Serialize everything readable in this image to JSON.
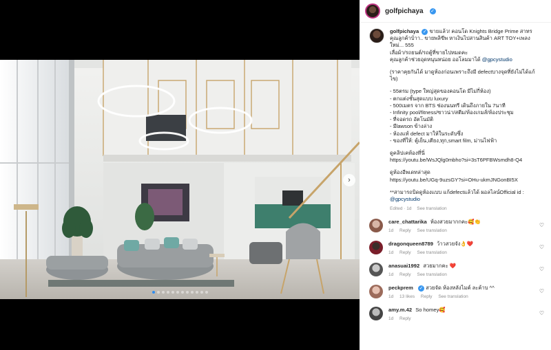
{
  "post": {
    "username": "golfpichaya",
    "carousel": {
      "total_slides": 12,
      "active_slide": 1
    }
  },
  "caption": {
    "username": "golfpichaya",
    "lines": [
      "ขายแล้ว! คอนโด Knights Bridge Prime สาทร",
      "คุณลูกค้าบ้าา.. ขายพลิขีพ หาเงินไปสานสินค้า ART TOY+เพลง",
      "ใหม่... 555",
      "เลื่อผ้า/รถยนต์/รถตู้ที่ขายไปหมดคะ",
      "คุณลูกค้าช่วยอุดหนุนหน่อย ออโลมมาได้"
    ],
    "mention1": "@gpcystudio",
    "paragraph2": [
      "(ราคาคุยกันได้ มาดูห้องก่อนเพราะถึงมี defectบางจุดที่ยังไม่ได้แก้",
      "ไข)"
    ],
    "features": [
      "- 55ตรม (type ใหญ่สุดของคอนโด มีไม่กี่ห้อง)",
      "- ตกแต่งชั้นสุดแบบ luxury",
      "- 500เมตร จาก BTS ช่องนนทรี เดินถึงภายใน 7นาที",
      "- Infinity pool/fitness/ซาวน่า/สตีม/ห้องเกมส์/ห้องประชุม",
      "- ที่จอดรถ อัตโนมัติ",
      "- มีlawson ข้างล่าง",
      "- ห้องแท้ defect มาให้ในระดับซึ่ง",
      "- ของที่ให้: ตู้เย็น,เตียง,ทุก,smart film, ม่านไฟฟ้า"
    ],
    "link1_label": "ดูคลิปเคห้องที่นี่",
    "link1_url": "https://youtu.be/WsJQlg0mbho?si=3sT6PFBWsmdh8-Q4",
    "link2_label": "ดูห้องอีพเดทล่าสุด",
    "link2_url": "https://youtu.be/UGq-9uzsGY?si=OHu-ukmJNGonBI5X",
    "footer_line": "**สามารถบิดดูห้องแบบ แก้defectแล้วได้ ผอลไลน์Official id :",
    "mention2": "@gpcystudio",
    "edited": "Edited · 1d",
    "see_translation": "See translation"
  },
  "comments": [
    {
      "username": "care_chattarika",
      "verified": false,
      "text": "ห้องสวยมากกคะ🥰👏",
      "time": "1d",
      "likes": "",
      "reply": "Reply",
      "translate": "See translation",
      "avatar_class": "av1"
    },
    {
      "username": "dragonqueen8789",
      "verified": false,
      "text": "ว้าวสวยจัง👌❤️",
      "time": "1d",
      "likes": "",
      "reply": "Reply",
      "translate": "See translation",
      "avatar_class": "av2"
    },
    {
      "username": "anasuai1992",
      "verified": false,
      "text": "สวยมากคะ ❤️",
      "time": "1d",
      "likes": "",
      "reply": "Reply",
      "translate": "See translation",
      "avatar_class": "av3"
    },
    {
      "username": "peckprem",
      "verified": true,
      "text": "สวยจัด ห้องหลังไมค์ ละค้าบ ^^",
      "time": "1d",
      "likes": "13 likes",
      "reply": "Reply",
      "translate": "See translation",
      "avatar_class": "av4"
    },
    {
      "username": "amy.m.42",
      "verified": false,
      "text": "So homey🥰",
      "time": "1d",
      "likes": "",
      "reply": "Reply",
      "translate": "",
      "avatar_class": "av5"
    }
  ],
  "icons": {
    "verified": "verified-badge-icon",
    "next": "chevron-right-icon",
    "like": "heart-outline-icon"
  },
  "colors": {
    "verified": "#3897f0",
    "link": "#00376b",
    "muted": "#8e8e8e",
    "carousel_active": "#2f8ef0"
  }
}
